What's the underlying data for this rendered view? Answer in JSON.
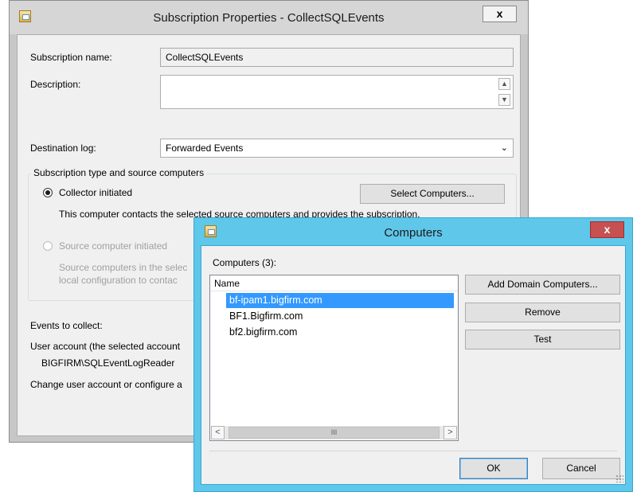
{
  "subscription_dialog": {
    "title": "Subscription Properties - CollectSQLEvents",
    "close_label": "x",
    "subscription_name_label": "Subscription name:",
    "subscription_name_value": "CollectSQLEvents",
    "description_label": "Description:",
    "description_value": "",
    "destination_log_label": "Destination log:",
    "destination_log_value": "Forwarded Events",
    "group_title": "Subscription type and source computers",
    "collector_initiated_label": "Collector initiated",
    "select_computers_label": "Select Computers...",
    "collector_initiated_desc": "This computer contacts the selected source computers and provides the subscription.",
    "source_initiated_label": "Source computer initiated",
    "source_desc_line1": "Source computers in the selec",
    "source_desc_line2": "local configuration to contac",
    "events_label": "Events to collect:",
    "user_account_label": "User account (the selected account",
    "user_account_value": "BIGFIRM\\SQLEventLogReader",
    "change_user_label": "Change user account or configure a"
  },
  "computers_dialog": {
    "title": "Computers",
    "close_label": "x",
    "count_label": "Computers (3):",
    "column_header": "Name",
    "computers": [
      "bf-ipam1.bigfirm.com",
      "BF1.Bigfirm.com",
      "bf2.bigfirm.com"
    ],
    "selected_index": 0,
    "scroll_thumb_glyph": "III",
    "add_domain_label": "Add Domain Computers...",
    "remove_label": "Remove",
    "test_label": "Test",
    "ok_label": "OK",
    "cancel_label": "Cancel"
  },
  "icons": {
    "scroll_up": "▲",
    "scroll_down": "▼",
    "scroll_left": "<",
    "scroll_right": ">",
    "dropdown": "⌄"
  }
}
